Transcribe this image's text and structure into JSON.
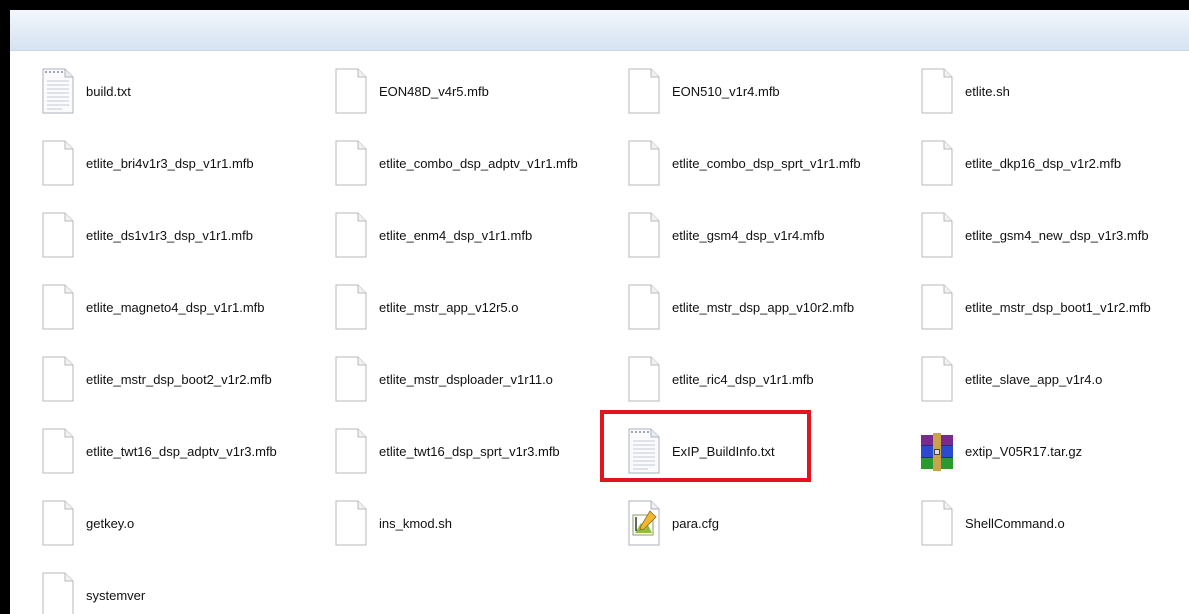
{
  "files": [
    {
      "name": "build.txt",
      "icon": "text-file-icon"
    },
    {
      "name": "EON48D_v4r5.mfb",
      "icon": "blank-file-icon"
    },
    {
      "name": "EON510_v1r4.mfb",
      "icon": "blank-file-icon"
    },
    {
      "name": "etlite.sh",
      "icon": "blank-file-icon"
    },
    {
      "name": "etlite_bri4v1r3_dsp_v1r1.mfb",
      "icon": "blank-file-icon"
    },
    {
      "name": "etlite_combo_dsp_adptv_v1r1.mfb",
      "icon": "blank-file-icon"
    },
    {
      "name": "etlite_combo_dsp_sprt_v1r1.mfb",
      "icon": "blank-file-icon"
    },
    {
      "name": "etlite_dkp16_dsp_v1r2.mfb",
      "icon": "blank-file-icon"
    },
    {
      "name": "etlite_ds1v1r3_dsp_v1r1.mfb",
      "icon": "blank-file-icon"
    },
    {
      "name": "etlite_enm4_dsp_v1r1.mfb",
      "icon": "blank-file-icon"
    },
    {
      "name": "etlite_gsm4_dsp_v1r4.mfb",
      "icon": "blank-file-icon"
    },
    {
      "name": "etlite_gsm4_new_dsp_v1r3.mfb",
      "icon": "blank-file-icon"
    },
    {
      "name": "etlite_magneto4_dsp_v1r1.mfb",
      "icon": "blank-file-icon"
    },
    {
      "name": "etlite_mstr_app_v12r5.o",
      "icon": "blank-file-icon"
    },
    {
      "name": "etlite_mstr_dsp_app_v10r2.mfb",
      "icon": "blank-file-icon"
    },
    {
      "name": "etlite_mstr_dsp_boot1_v1r2.mfb",
      "icon": "blank-file-icon"
    },
    {
      "name": "etlite_mstr_dsp_boot2_v1r2.mfb",
      "icon": "blank-file-icon"
    },
    {
      "name": "etlite_mstr_dsploader_v1r11.o",
      "icon": "blank-file-icon"
    },
    {
      "name": "etlite_ric4_dsp_v1r1.mfb",
      "icon": "blank-file-icon"
    },
    {
      "name": "etlite_slave_app_v1r4.o",
      "icon": "blank-file-icon"
    },
    {
      "name": "etlite_twt16_dsp_adptv_v1r3.mfb",
      "icon": "blank-file-icon"
    },
    {
      "name": "etlite_twt16_dsp_sprt_v1r3.mfb",
      "icon": "blank-file-icon"
    },
    {
      "name": "ExIP_BuildInfo.txt",
      "icon": "text-file-icon",
      "highlighted": true
    },
    {
      "name": "extip_V05R17.tar.gz",
      "icon": "winrar-archive-icon"
    },
    {
      "name": "getkey.o",
      "icon": "blank-file-icon"
    },
    {
      "name": "ins_kmod.sh",
      "icon": "blank-file-icon"
    },
    {
      "name": "para.cfg",
      "icon": "config-file-icon"
    },
    {
      "name": "ShellCommand.o",
      "icon": "blank-file-icon"
    },
    {
      "name": "systemver",
      "icon": "blank-file-icon"
    }
  ],
  "colors": {
    "highlight": "#e3141e",
    "background": "#ffffff",
    "topbar": "#e2ebf6"
  }
}
